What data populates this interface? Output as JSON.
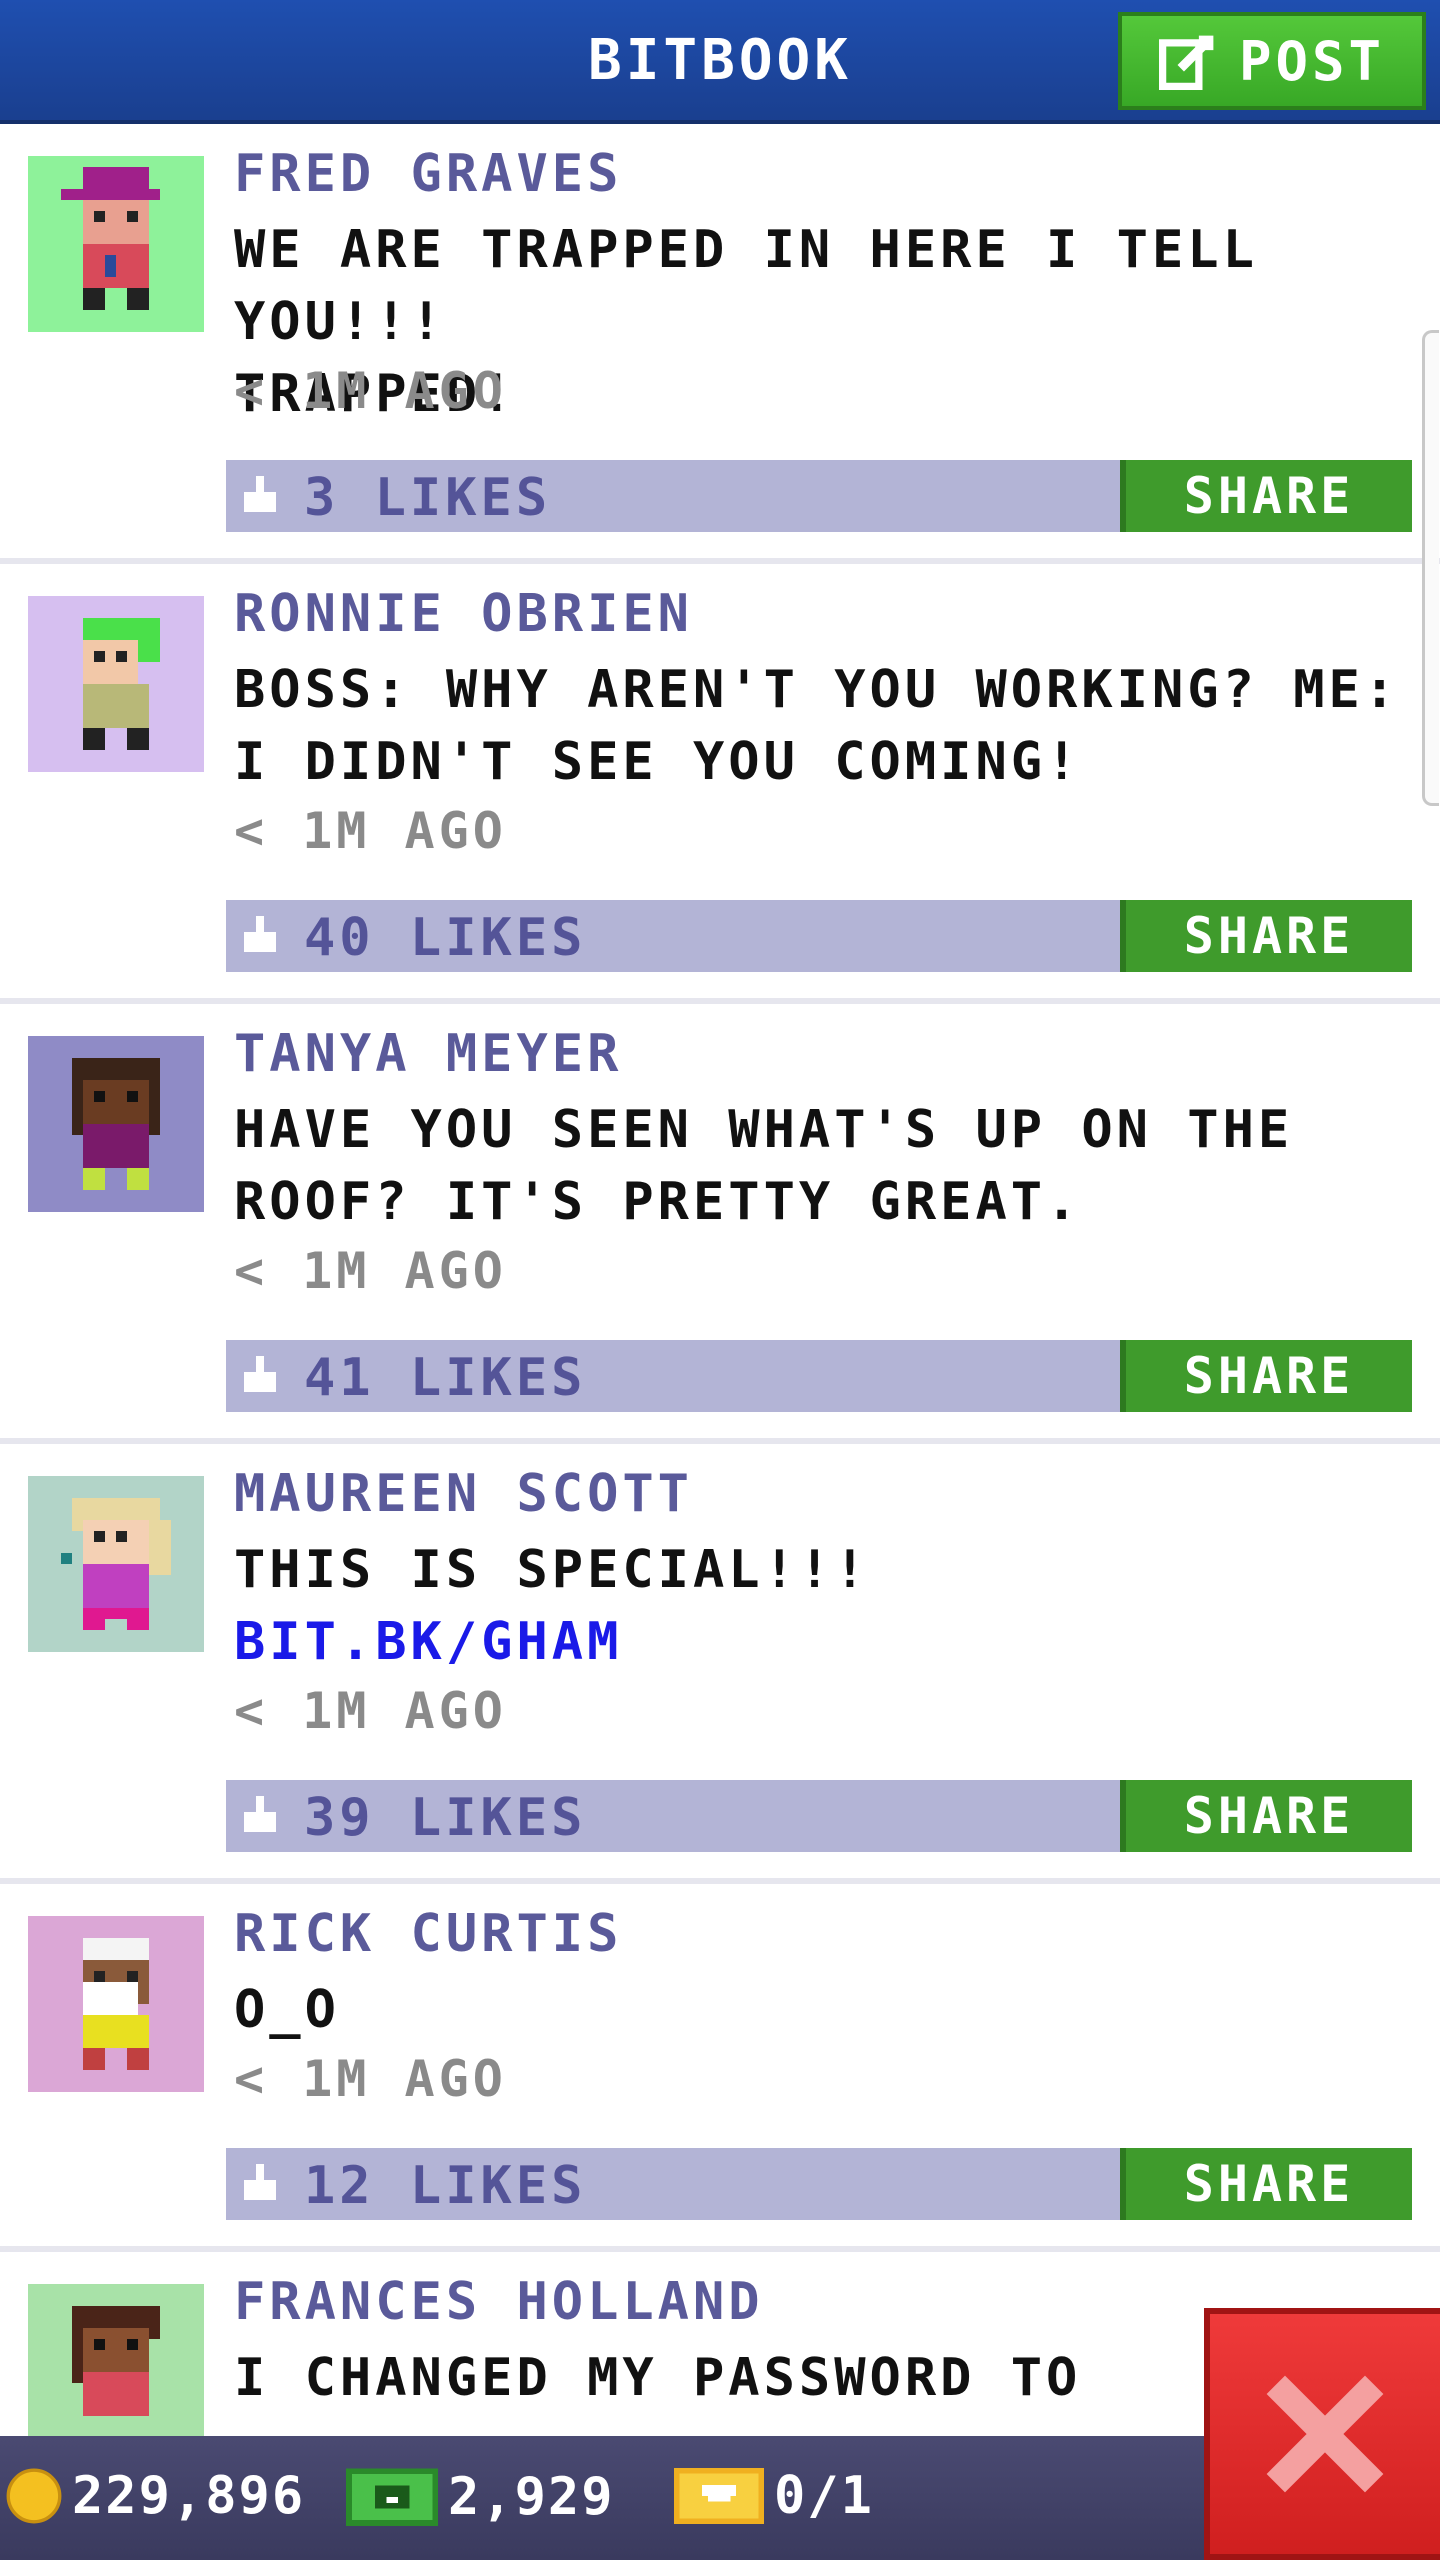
{
  "header": {
    "title": "BITBOOK",
    "post_label": "POST"
  },
  "posts": [
    {
      "name": "FRED GRAVES",
      "lines": [
        "WE ARE TRAPPED IN HERE I TELL YOU!!!",
        "TRAPPED!"
      ],
      "link": "",
      "time": "< 1M AGO",
      "likes": "3 LIKES",
      "share": "SHARE",
      "avatar_bg": "#8ef29a"
    },
    {
      "name": "RONNIE OBRIEN",
      "lines": [
        "BOSS: WHY AREN'T YOU WORKING? ME:",
        "I DIDN'T SEE YOU COMING!"
      ],
      "link": "",
      "time": "< 1M AGO",
      "likes": "40 LIKES",
      "share": "SHARE",
      "avatar_bg": "#d6bff0"
    },
    {
      "name": "TANYA MEYER",
      "lines": [
        "HAVE YOU SEEN WHAT'S UP ON THE",
        "ROOF? IT'S PRETTY GREAT."
      ],
      "link": "",
      "time": "< 1M AGO",
      "likes": "41 LIKES",
      "share": "SHARE",
      "avatar_bg": "#8f8bc6"
    },
    {
      "name": "MAUREEN SCOTT",
      "lines": [
        "THIS IS SPECIAL!!!"
      ],
      "link": "BIT.BK/GHAM",
      "time": "< 1M AGO",
      "likes": "39 LIKES",
      "share": "SHARE",
      "avatar_bg": "#b2d4c8"
    },
    {
      "name": "RICK CURTIS",
      "lines": [
        "O_O"
      ],
      "link": "",
      "time": "< 1M AGO",
      "likes": "12 LIKES",
      "share": "SHARE",
      "avatar_bg": "#dba7d6"
    },
    {
      "name": "FRANCES HOLLAND",
      "lines": [
        "I CHANGED MY PASSWORD TO"
      ],
      "link": "",
      "time": "",
      "likes": "",
      "share": "",
      "avatar_bg": "#a8e2a8"
    }
  ],
  "footer": {
    "coins": "229,896",
    "bux": "2,929",
    "tickets": "0/1"
  },
  "colors": {
    "header_blue": "#1f4fb0",
    "post_green": "#3f9b2c",
    "likebar": "#b3b4d6",
    "name_purple": "#5a5a9a",
    "close_red": "#e02a2a"
  }
}
